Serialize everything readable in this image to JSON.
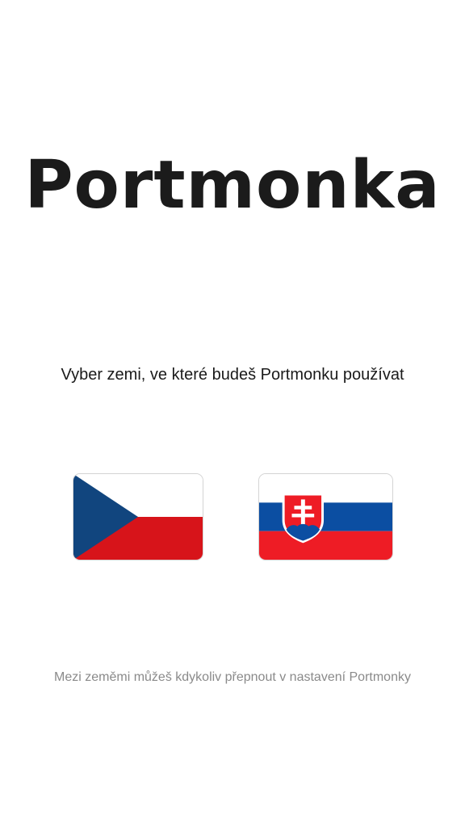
{
  "app": {
    "logo_text": "Portmonka"
  },
  "prompt": "Vyber zemi, ve které budeš Portmonku používat",
  "countries": [
    {
      "id": "cz",
      "flag_icon": "czech-flag-icon",
      "colors": {
        "white": "#ffffff",
        "red": "#d7141a",
        "blue": "#11457e"
      }
    },
    {
      "id": "sk",
      "flag_icon": "slovak-flag-icon",
      "colors": {
        "white": "#ffffff",
        "blue": "#0b4ea2",
        "red": "#ee1c25"
      }
    }
  ],
  "hint": "Mezi zeměmi můžeš kdykoliv přepnout v nastavení Portmonky"
}
